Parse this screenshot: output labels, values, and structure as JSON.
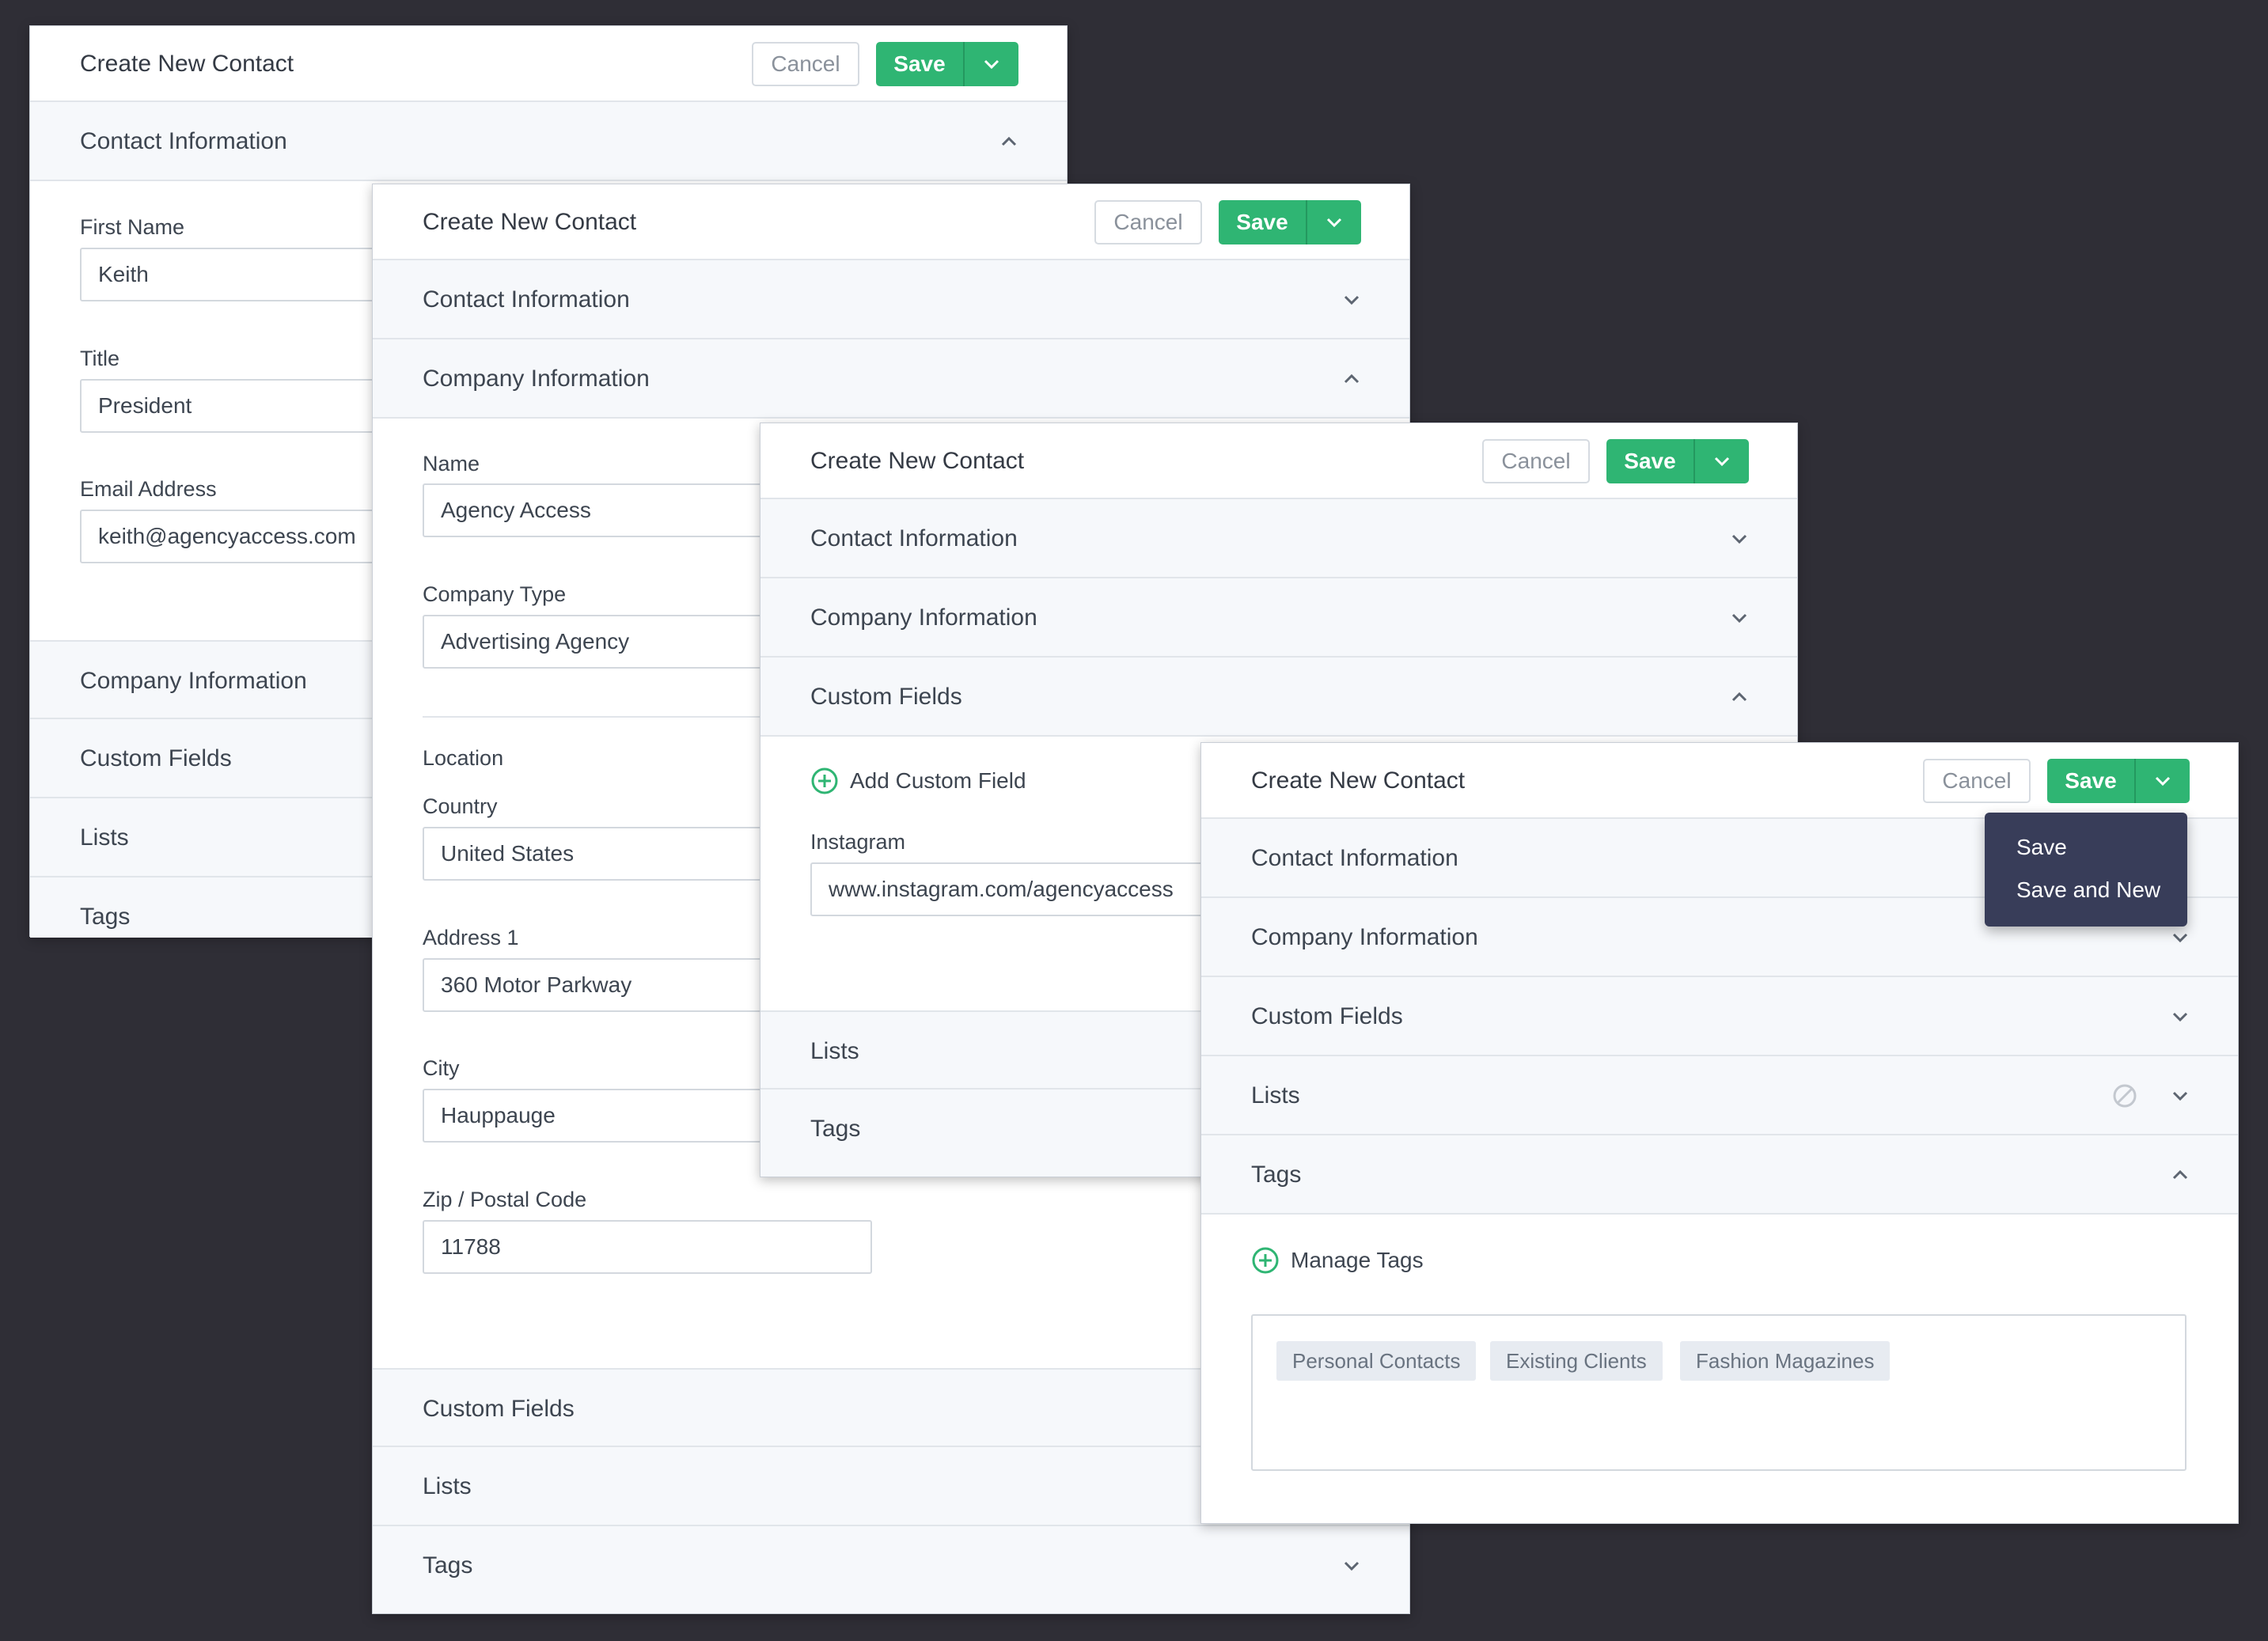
{
  "colors": {
    "background": "#2f2e36",
    "save_green": "#2fb573",
    "dropdown_bg": "#383d59",
    "section_bg": "#f6f8fb"
  },
  "panels": [
    {
      "title": "Create New Contact",
      "cancel_label": "Cancel",
      "save_label": "Save",
      "sections": {
        "contact_information": "Contact Information",
        "company_information": "Company Information",
        "custom_fields": "Custom Fields",
        "lists": "Lists",
        "tags": "Tags"
      },
      "fields": {
        "first_name": {
          "label": "First Name",
          "value": "Keith"
        },
        "title": {
          "label": "Title",
          "value": "President"
        },
        "email": {
          "label": "Email Address",
          "value": "keith@agencyaccess.com"
        }
      }
    },
    {
      "title": "Create New Contact",
      "cancel_label": "Cancel",
      "save_label": "Save",
      "sections": {
        "contact_information": "Contact Information",
        "company_information": "Company Information",
        "custom_fields": "Custom Fields",
        "lists": "Lists",
        "tags": "Tags"
      },
      "fields": {
        "name": {
          "label": "Name",
          "value": "Agency Access"
        },
        "company_type": {
          "label": "Company Type",
          "value": "Advertising Agency"
        },
        "location_heading": "Location",
        "country": {
          "label": "Country",
          "value": "United States"
        },
        "address1": {
          "label": "Address 1",
          "value": "360 Motor Parkway"
        },
        "city": {
          "label": "City",
          "value": "Hauppauge"
        },
        "zip": {
          "label": "Zip / Postal Code",
          "value": "11788"
        }
      }
    },
    {
      "title": "Create New Contact",
      "cancel_label": "Cancel",
      "save_label": "Save",
      "sections": {
        "contact_information": "Contact Information",
        "company_information": "Company Information",
        "custom_fields": "Custom Fields",
        "lists": "Lists",
        "tags": "Tags"
      },
      "add_custom_field_label": "Add Custom Field",
      "fields": {
        "instagram": {
          "label": "Instagram",
          "value": "www.instagram.com/agencyaccess"
        }
      }
    },
    {
      "title": "Create New Contact",
      "cancel_label": "Cancel",
      "save_label": "Save",
      "sections": {
        "contact_information": "Contact Information",
        "company_information": "Company Information",
        "custom_fields": "Custom Fields",
        "lists": "Lists",
        "tags": "Tags"
      },
      "manage_tags_label": "Manage Tags",
      "tags": [
        "Personal Contacts",
        "Existing Clients",
        "Fashion Magazines"
      ],
      "save_dropdown": [
        "Save",
        "Save and New"
      ]
    }
  ],
  "icons": {
    "chevron_up": "chevron-up-icon",
    "chevron_down": "chevron-down-icon",
    "add": "plus-circle-icon",
    "disabled": "ban-icon"
  }
}
